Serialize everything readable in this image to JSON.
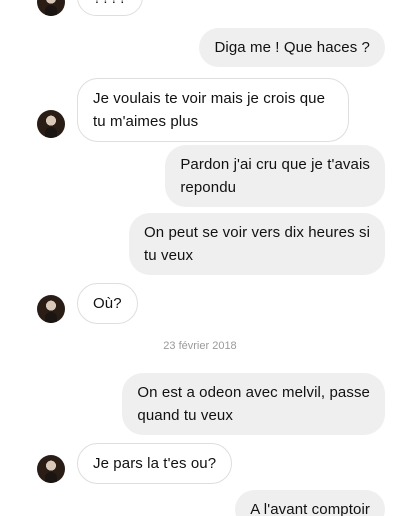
{
  "thread": {
    "messages": [
      {
        "id": "m0",
        "side": "in",
        "text": "????"
      },
      {
        "id": "m1",
        "side": "out",
        "text": "Diga me ! Que haces ?"
      },
      {
        "id": "m2",
        "side": "in",
        "text": "Je voulais te voir mais je crois que\ntu m'aimes plus"
      },
      {
        "id": "m3",
        "side": "out",
        "text": "Pardon j'ai cru que je t'avais\nrepondu"
      },
      {
        "id": "m4",
        "side": "out",
        "text": "On peut se voir vers dix heures si\ntu veux"
      },
      {
        "id": "m5",
        "side": "in",
        "text": "Où?"
      },
      {
        "id": "m6",
        "side": "out",
        "text": "On est a odeon avec melvil, passe\nquand tu veux"
      },
      {
        "id": "m7",
        "side": "in",
        "text": "Je pars la t'es ou?"
      },
      {
        "id": "m8",
        "side": "out",
        "text": "A l'avant comptoir"
      }
    ],
    "date_separator": "23 février 2018"
  },
  "colors": {
    "outgoing_bubble": "#efefef",
    "incoming_border": "#dedede",
    "timestamp": "#9a9a9a"
  },
  "icons": {
    "avatar": "contact-avatar"
  }
}
